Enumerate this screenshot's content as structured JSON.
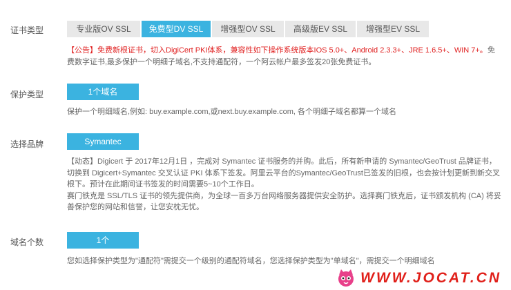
{
  "cert_type": {
    "label": "证书类型",
    "tabs": [
      {
        "label": "专业版OV SSL",
        "active": false
      },
      {
        "label": "免费型DV SSL",
        "active": true
      },
      {
        "label": "增强型OV SSL",
        "active": false
      },
      {
        "label": "高级版EV SSL",
        "active": false
      },
      {
        "label": "增强型EV SSL",
        "active": false
      }
    ],
    "notice_red": "【公告】免费新根证书，切入DigiCert PKI体系，兼容性如下操作系统版本IOS 5.0+、Android 2.3.3+、JRE 1.6.5+、WIN 7+。",
    "notice_rest": "免费数字证书,最多保护一个明细子域名,不支持通配符，一个阿云帐户最多签发20张免费证书。"
  },
  "protection_type": {
    "label": "保护类型",
    "value": "1个域名",
    "desc": "保护一个明细域名,例如: buy.example.com,或next.buy.example.com, 各个明细子域名都算一个域名"
  },
  "brand": {
    "label": "选择品牌",
    "value": "Symantec",
    "desc_line1": "【动态】Digicert 于 2017年12月1日 ，完成对 Symantec 证书服务的并购。此后，所有新申请的 Symantec/GeoTrust 品牌证书，切换到 Digicert+Symantec 交叉认证 PKI 体系下签发。阿里云平台的Symantec/GeoTrust已签发的旧根，也会按计划更新到新交叉根下。预计在此期间证书签发的时间需要5~10个工作日。",
    "desc_line2": "赛门铁克是 SSL/TLS 证书的领先提供商，为全球一百多万台网络服务器提供安全防护。选择赛门铁克后，证书颁发机构 (CA) 将妥善保护您的网站和信誉，让您安枕无忧。"
  },
  "domain_count": {
    "label": "域名个数",
    "value": "1个",
    "desc": "您如选择保护类型为\"通配符\"需提交一个级别的通配符域名，您选择保护类型为\"单域名\"，需提交一个明细域名"
  },
  "watermark": {
    "text": "WWW.JOCAT.CN",
    "icon": "cat-icon",
    "color": "#e0201a"
  },
  "colors": {
    "accent": "#3bb3e0",
    "notice_red": "#e02020"
  }
}
